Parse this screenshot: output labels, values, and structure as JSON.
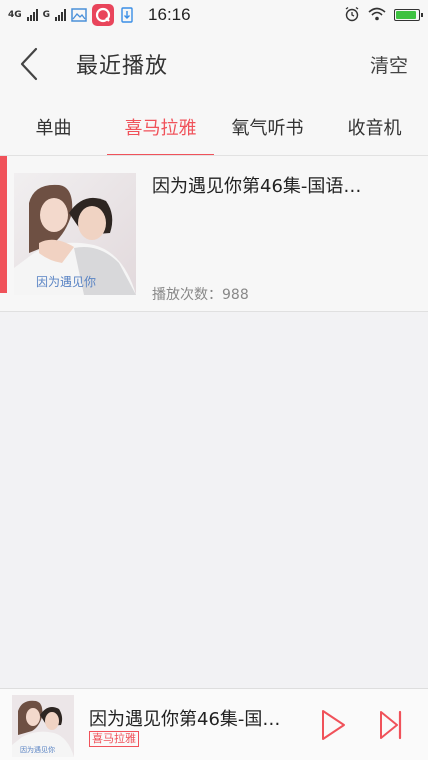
{
  "status_bar": {
    "net1": "4G",
    "net2": "G",
    "time": "16:16",
    "battery_level": 0.9
  },
  "header": {
    "title": "最近播放",
    "clear_label": "清空"
  },
  "tabs": [
    {
      "label": "单曲",
      "active": false
    },
    {
      "label": "喜马拉雅",
      "active": true
    },
    {
      "label": "氧气听书",
      "active": false
    },
    {
      "label": "收音机",
      "active": false
    }
  ],
  "list": {
    "items": [
      {
        "title": "因为遇见你第46集-国语…",
        "play_count": "播放次数：988",
        "cover_text": "因为遇见你"
      }
    ]
  },
  "player": {
    "title": "因为遇见你第46集-国…",
    "source_badge": "喜马拉雅",
    "cover_text": "因为遇见你"
  },
  "colors": {
    "accent": "#f0525a",
    "background": "#f2f2f4"
  }
}
